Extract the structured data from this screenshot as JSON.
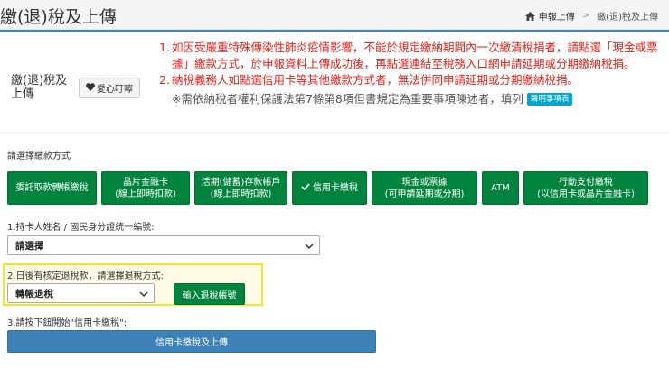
{
  "header": {
    "title": "繳(退)稅及上傳",
    "breadcrumb": {
      "home_icon": "home-icon",
      "link": "申報上傳",
      "separator": ">",
      "current": "繳(退)稅及上傳"
    }
  },
  "info": {
    "label": "繳(退)稅及上傳",
    "love_button": {
      "icon": "heart-icon",
      "label": "愛心叮嚀"
    },
    "notes": [
      {
        "num": "1.",
        "text": "如因受嚴重特殊傳染性肺炎疫情影響，不能於規定繳納期間內一次繳清稅捐者，請點選「現金或票據」繳款方式，於申報資料上傳成功後，再點選連結至稅務入口網申請延期或分期繳納稅捐。"
      },
      {
        "num": "2.",
        "text": "納稅義務人如點選信用卡等其他繳款方式者，無法併同申請延期或分期繳納稅捐。"
      }
    ],
    "legal_note": "※需依納稅者權利保護法第7條第8項但書規定為重要事項陳述者，填列",
    "legal_tag": "聲明事項表"
  },
  "payment": {
    "label": "請選擇繳款方式",
    "methods": [
      {
        "line1": "委託取款轉帳繳稅",
        "line2": ""
      },
      {
        "line1": "晶片金融卡",
        "line2": "(線上即時扣款)"
      },
      {
        "line1": "活期(儲蓄)存款帳戶",
        "line2": "(線上即時扣款)"
      },
      {
        "line1": "信用卡繳稅",
        "line2": "",
        "selected": true,
        "icon": "check-icon"
      },
      {
        "line1": "現金或票據",
        "line2": "(可申請延期或分期)"
      },
      {
        "line1": "ATM",
        "line2": ""
      },
      {
        "line1": "行動支付繳稅",
        "line2": "(以信用卡或晶片金融卡)"
      }
    ]
  },
  "step1": {
    "label": "1.持卡人姓名 / 國民身分證統一編號:",
    "value": "請選擇"
  },
  "step2": {
    "label": "2.日後有核定退稅款，請選擇退稅方式:",
    "value": "轉帳退稅",
    "button": "輸入退稅帳號"
  },
  "step3": {
    "label": "3.請按下鈕開始\"信用卡繳稅\":",
    "button": "信用卡繳稅及上傳"
  },
  "colors": {
    "primary": "#3c8dbc",
    "green": "#00843d",
    "red": "#e2231a",
    "highlight_border": "#f3e42e",
    "tag": "#00a7d0"
  }
}
